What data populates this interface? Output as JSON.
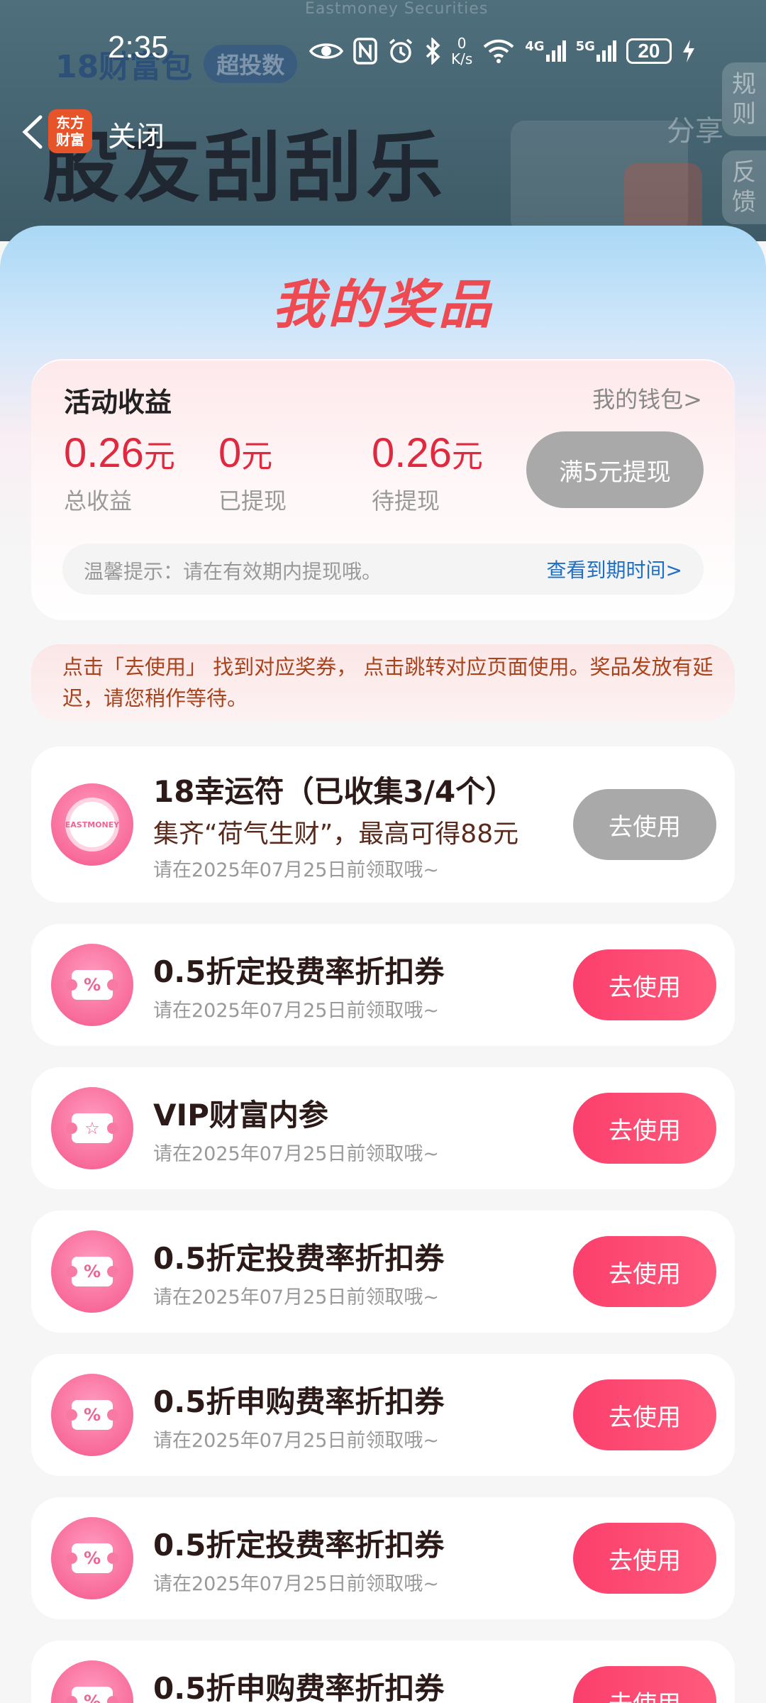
{
  "status_bar": {
    "time": "2:35",
    "network_speed": "0",
    "network_speed_unit": "K/s",
    "signal_4g": "4G",
    "signal_5g": "5G",
    "battery": "20"
  },
  "background": {
    "brand_en": "Eastmoney Securities",
    "banner_tag_prefix": "18财富包",
    "banner_tag": "超投数",
    "banner_title": "股友刮刮乐",
    "share": "分享",
    "side_tab_rules": "规则",
    "side_tab_feedback": "反馈"
  },
  "nav": {
    "logo_line1": "东方",
    "logo_line2": "财富",
    "close": "关闭"
  },
  "panel": {
    "title": "我的奖品"
  },
  "earnings": {
    "title": "活动收益",
    "wallet_link": "我的钱包>",
    "stats": [
      {
        "value": "0.26",
        "unit": "元",
        "label": "总收益"
      },
      {
        "value": "0",
        "unit": "元",
        "label": "已提现"
      },
      {
        "value": "0.26",
        "unit": "元",
        "label": "待提现"
      }
    ],
    "withdraw_button": "满5元提现",
    "tip": "温馨提示：请在有效期内提现哦。",
    "tip_link": "查看到期时间>"
  },
  "notice": "点击「去使用」 找到对应奖券， 点击跳转对应页面使用。奖品发放有延迟，请您稍作等待。",
  "prizes": [
    {
      "title": "18幸运符（已收集3/4个）",
      "subtitle": "集齐“荷气生财”，最高可得88元",
      "expiry": "请在2025年07月25日前领取哦~",
      "button": "去使用",
      "icon": "lucky-charm-icon",
      "icon_text": "EASTMONEY",
      "enabled": false
    },
    {
      "title": "0.5折定投费率折扣券",
      "expiry": "请在2025年07月25日前领取哦~",
      "button": "去使用",
      "icon": "coupon-percent-icon",
      "icon_text": "%",
      "enabled": true
    },
    {
      "title": "VIP财富内参",
      "expiry": "请在2025年07月25日前领取哦~",
      "button": "去使用",
      "icon": "coupon-star-icon",
      "icon_text": "☆",
      "enabled": true
    },
    {
      "title": "0.5折定投费率折扣券",
      "expiry": "请在2025年07月25日前领取哦~",
      "button": "去使用",
      "icon": "coupon-percent-icon",
      "icon_text": "%",
      "enabled": true
    },
    {
      "title": "0.5折申购费率折扣券",
      "expiry": "请在2025年07月25日前领取哦~",
      "button": "去使用",
      "icon": "coupon-percent-icon",
      "icon_text": "%",
      "enabled": true
    },
    {
      "title": "0.5折定投费率折扣券",
      "expiry": "请在2025年07月25日前领取哦~",
      "button": "去使用",
      "icon": "coupon-percent-icon",
      "icon_text": "%",
      "enabled": true
    },
    {
      "title": "0.5折申购费率折扣券",
      "expiry": "",
      "button": "去使用",
      "icon": "coupon-percent-icon",
      "icon_text": "%",
      "enabled": true
    }
  ],
  "colors": {
    "accent_red": "#e0283f",
    "button_pink": "#fb3f6c",
    "disabled_gray": "#a9a9a9",
    "link_blue": "#1f6fc7"
  }
}
